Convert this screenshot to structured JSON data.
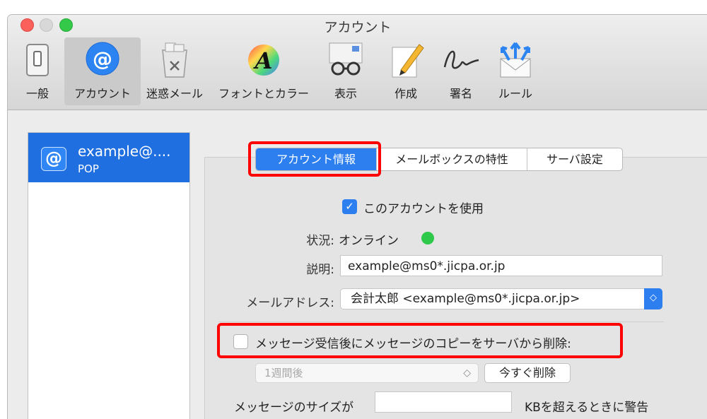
{
  "window": {
    "title": "アカウント"
  },
  "toolbar": {
    "items": [
      {
        "label": "一般",
        "icon": "general-switch-icon"
      },
      {
        "label": "アカウント",
        "icon": "at-sign-icon"
      },
      {
        "label": "迷惑メール",
        "icon": "junk-mail-bin-icon"
      },
      {
        "label": "フォントとカラー",
        "icon": "font-color-icon"
      },
      {
        "label": "表示",
        "icon": "glasses-icon"
      },
      {
        "label": "作成",
        "icon": "pencil-icon"
      },
      {
        "label": "署名",
        "icon": "signature-icon"
      },
      {
        "label": "ルール",
        "icon": "rules-envelope-icon"
      }
    ],
    "selected": "アカウント"
  },
  "accounts": [
    {
      "name": "example@....",
      "type": "POP",
      "icon": "at-sign-icon"
    }
  ],
  "tabs": [
    {
      "label": "アカウント情報",
      "selected": true
    },
    {
      "label": "メールボックスの特性",
      "selected": false
    },
    {
      "label": "サーバ設定",
      "selected": false
    }
  ],
  "form": {
    "enable_label": "このアカウントを使用",
    "enable_checked": true,
    "status_label": "状況:",
    "status_value": "オンライン",
    "status_color": "#2ec84a",
    "description_label": "説明:",
    "description_value": "example@ms0*.jicpa.or.jp",
    "email_label": "メールアドレス:",
    "email_value": "会計太郎  <example@ms0*.jicpa.or.jp>",
    "delete_label": "メッセージ受信後にメッセージのコピーをサーバから削除:",
    "delete_checked": false,
    "delete_period": "1週間後",
    "delete_now_label": "今すぐ削除",
    "size_label_prefix": "メッセージのサイズが",
    "size_value": "",
    "size_label_suffix": "KBを超えるときに警告"
  },
  "colors": {
    "accent": "#2d7ff0",
    "highlight": "#ff0000",
    "selection": "#1f6fe0"
  }
}
